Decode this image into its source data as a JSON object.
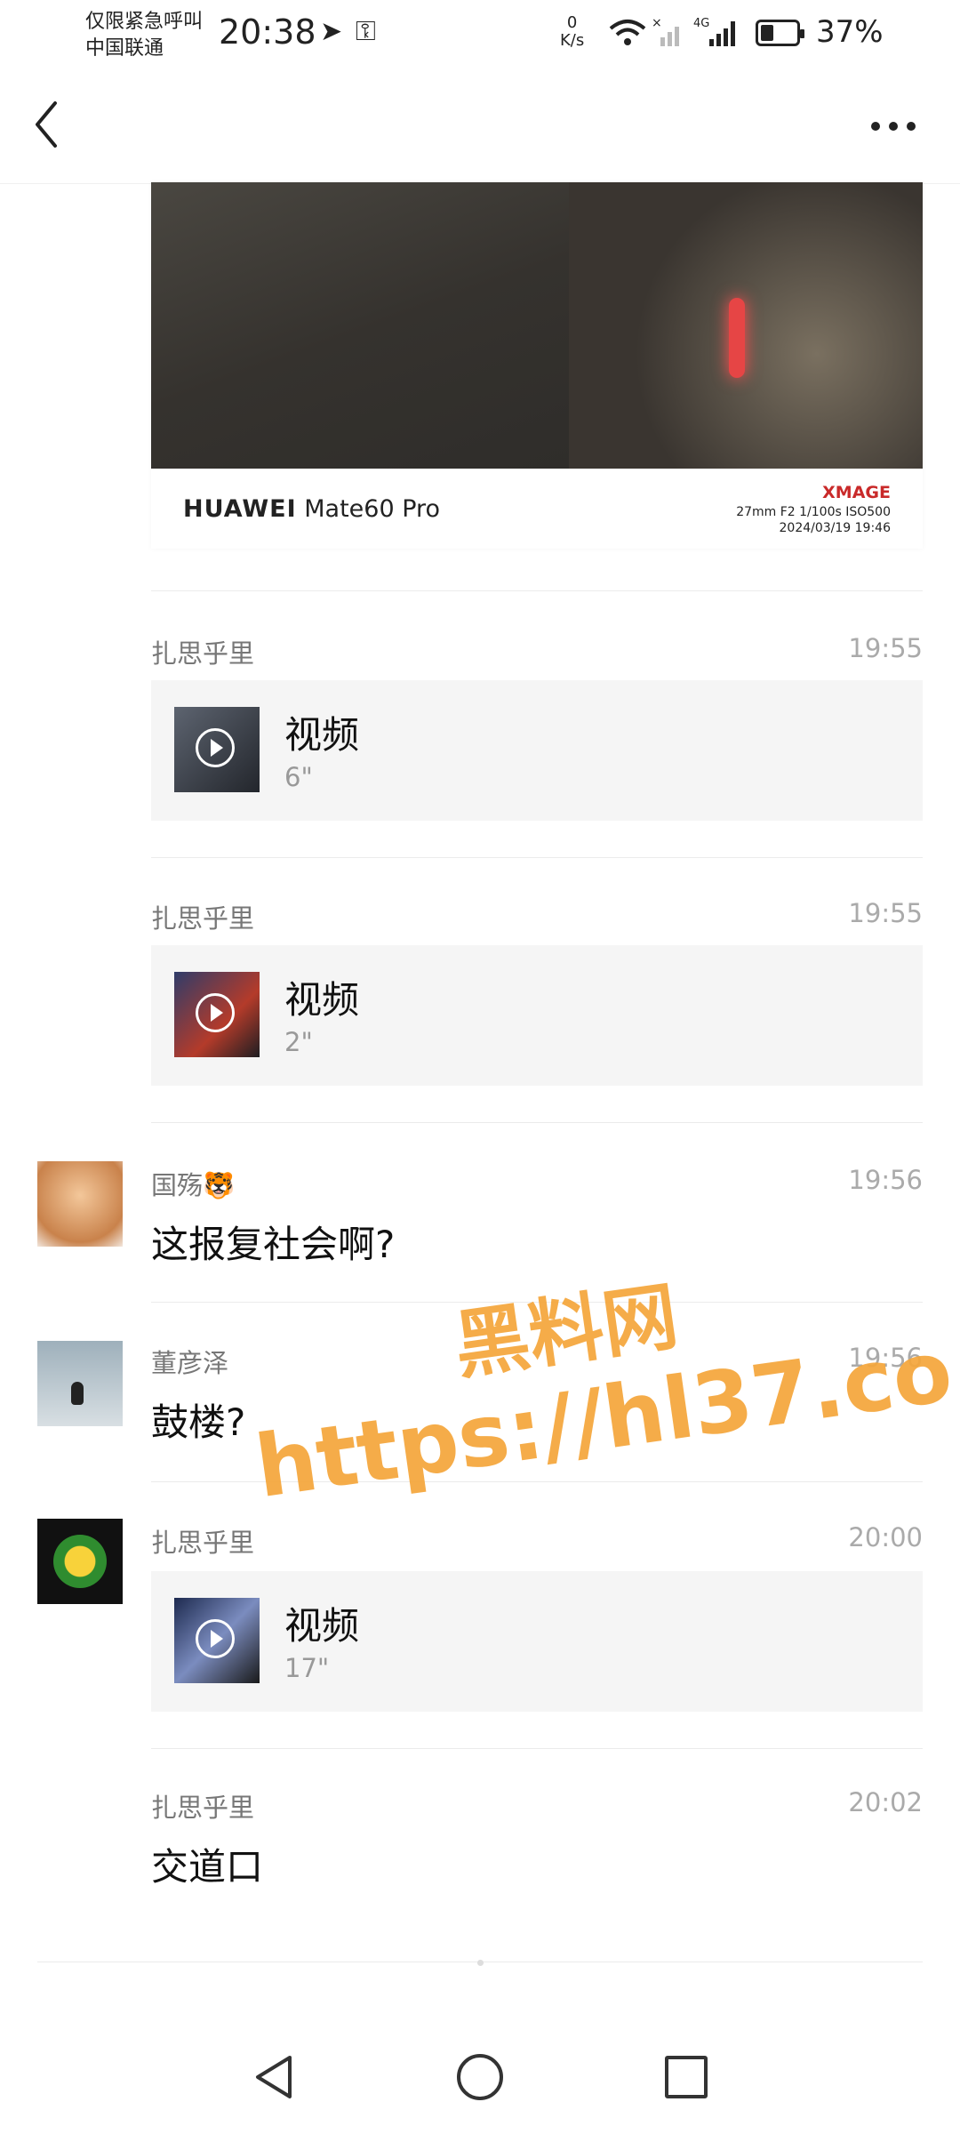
{
  "status_bar": {
    "carrier_line1": "仅限紧急呼叫",
    "carrier_line2": "中国联通",
    "time": "20:38",
    "net_speed_value": "0",
    "net_speed_unit": "K/s",
    "signal_label": "4G",
    "battery_percent": "37%",
    "battery_level": 0.37
  },
  "messages": [
    {
      "type": "photo",
      "camera_brand": "HUAWEI",
      "camera_model": "Mate60 Pro",
      "badge": "XMAGE",
      "exif_line1": "27mm  F2  1/100s  ISO500",
      "exif_line2": "2024/03/19  19:46"
    },
    {
      "type": "video",
      "sender": "扎思乎里",
      "time": "19:55",
      "title": "视频",
      "duration": "6\""
    },
    {
      "type": "video",
      "sender": "扎思乎里",
      "time": "19:55",
      "title": "视频",
      "duration": "2\""
    },
    {
      "type": "text",
      "sender": "国殇🐯",
      "time": "19:56",
      "text": "这报复社会啊?"
    },
    {
      "type": "text",
      "sender": "董彦泽",
      "time": "19:56",
      "text": "鼓楼?"
    },
    {
      "type": "video",
      "sender": "扎思乎里",
      "time": "20:00",
      "title": "视频",
      "duration": "17\""
    },
    {
      "type": "text",
      "sender": "扎思乎里",
      "time": "20:02",
      "text": "交道口"
    }
  ],
  "watermark": {
    "line1": "黑料网",
    "line2": "https://hl37.co"
  }
}
